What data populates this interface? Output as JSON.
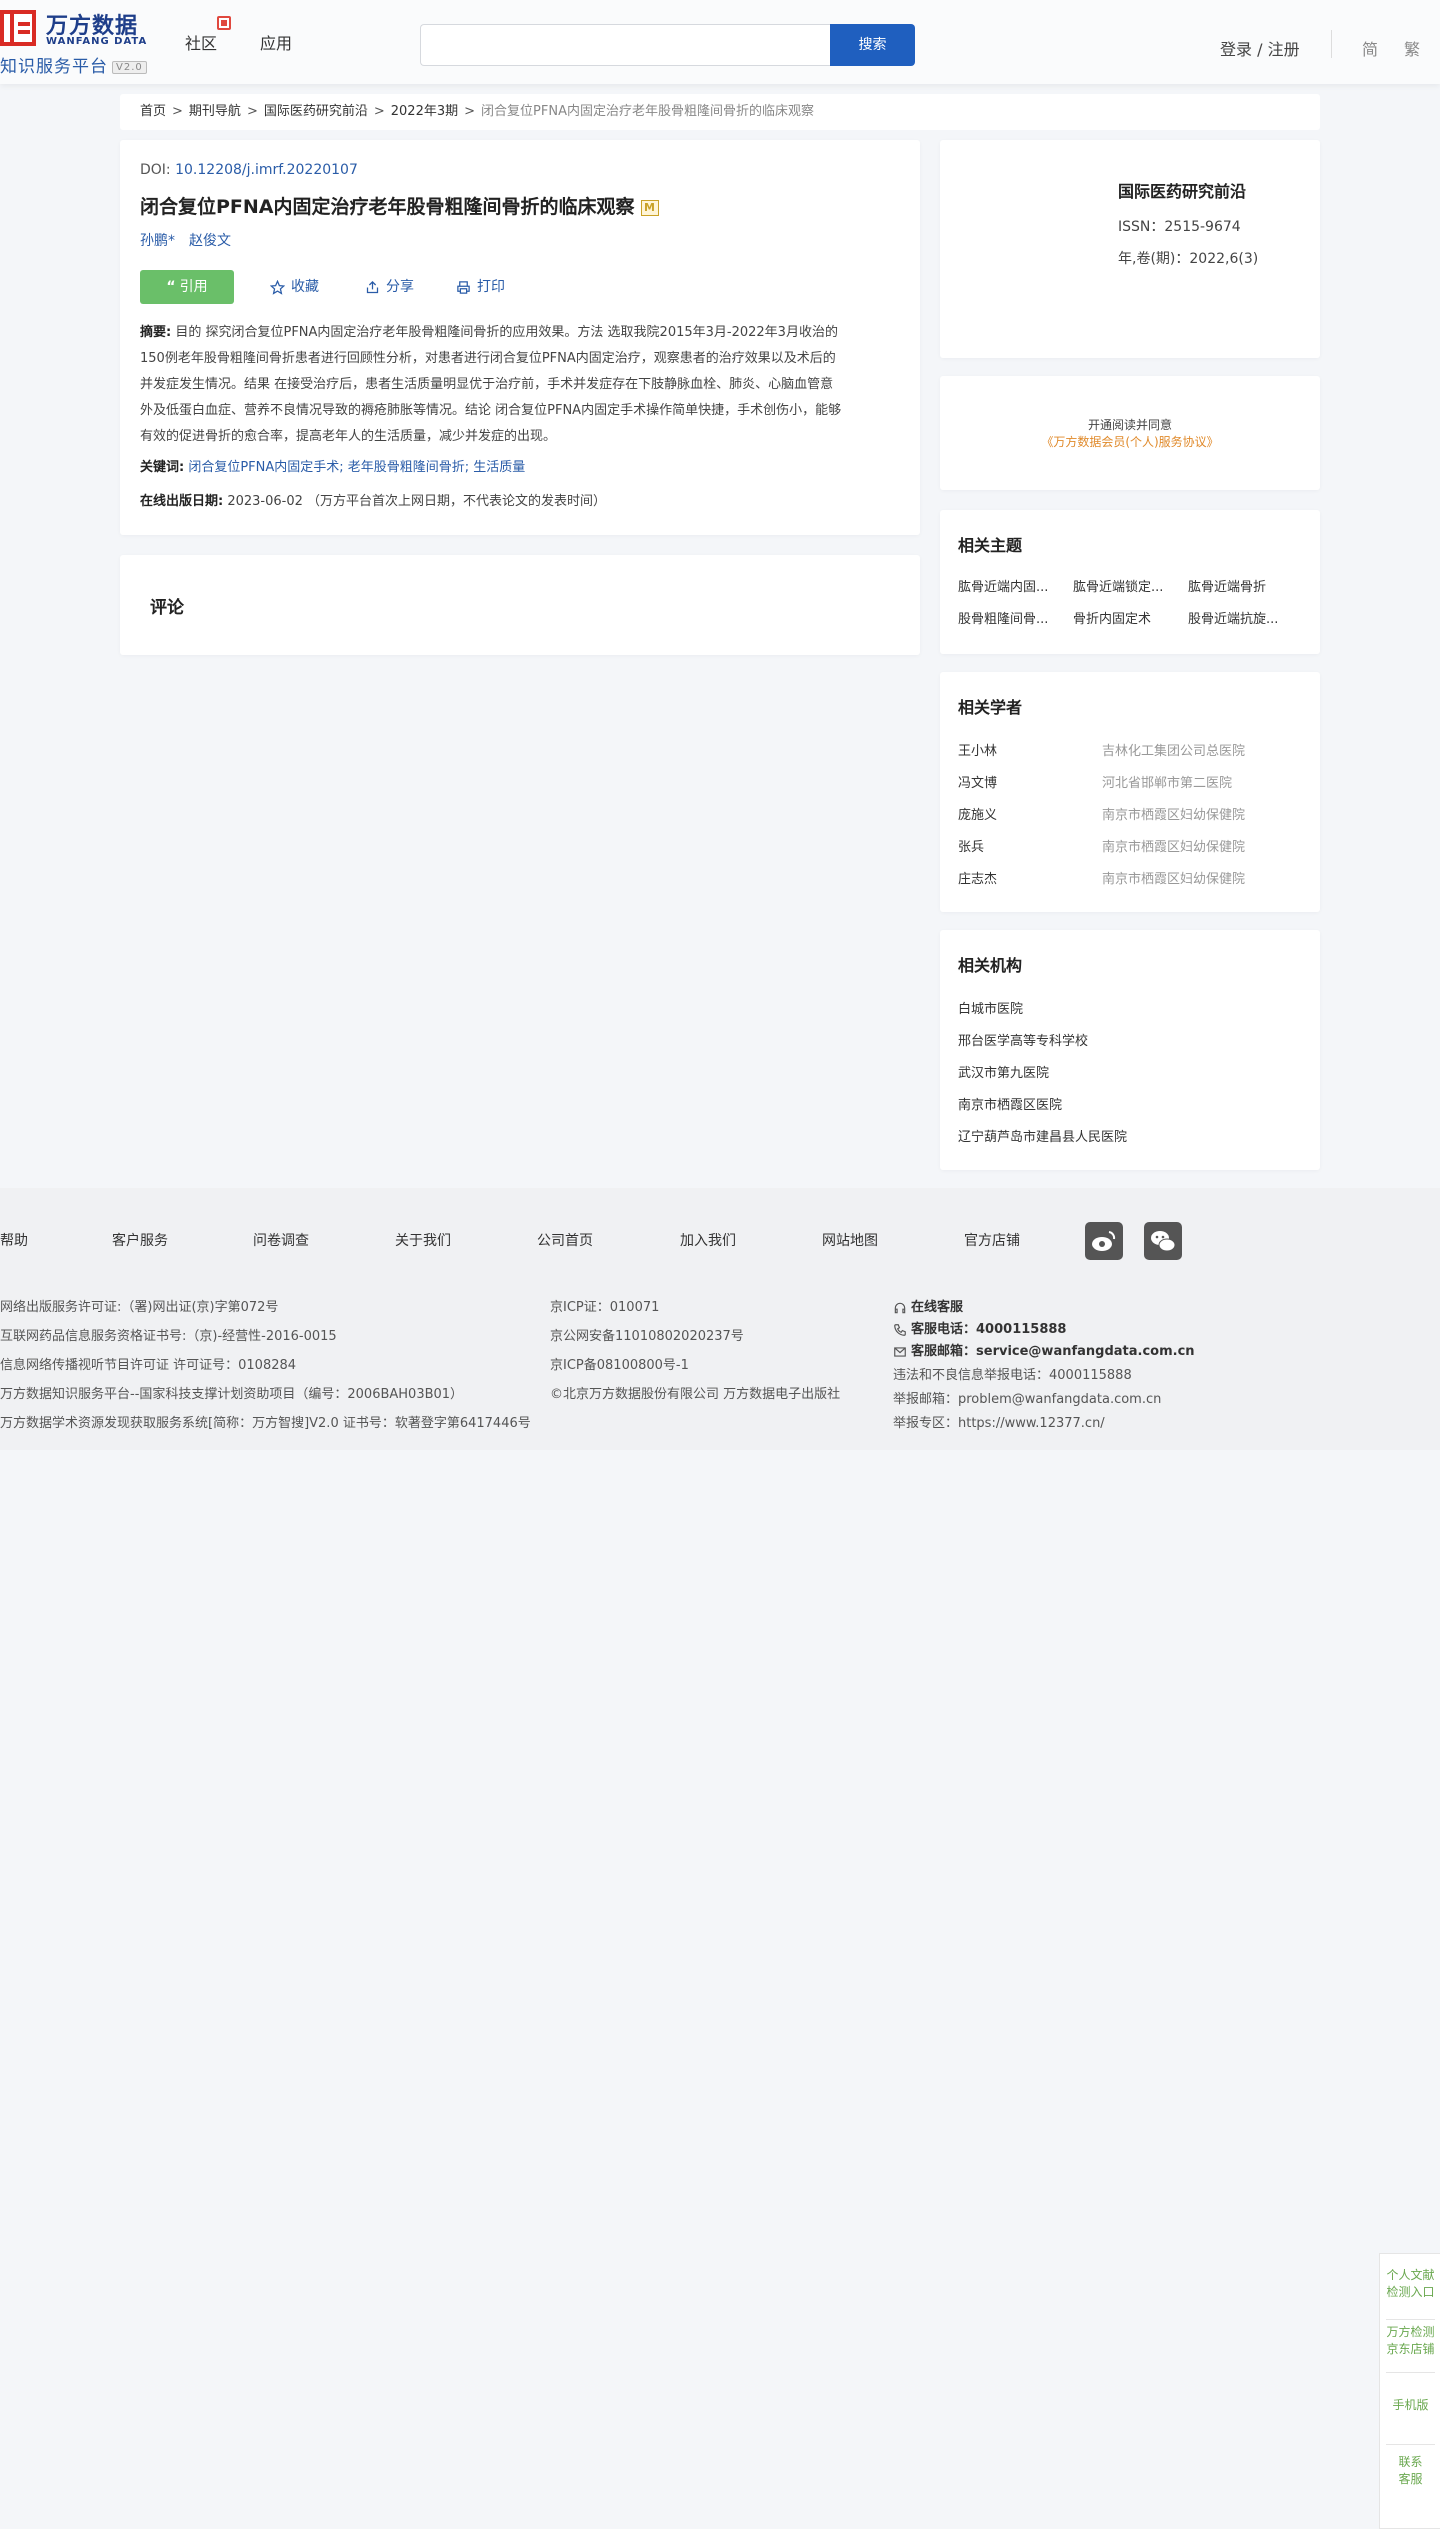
{
  "header": {
    "logo_cn": "万方数据",
    "logo_en": "WANFANG DATA",
    "logo_sub": "知识服务平台",
    "logo_ver": "V2.0",
    "nav_community": "社区",
    "nav_apps": "应用",
    "search_placeholder": "",
    "search_button": "搜索",
    "login": "登录 / 注册",
    "lang_simplified": "简",
    "lang_traditional": "繁"
  },
  "breadcrumb": {
    "items": [
      "首页",
      "期刊导航",
      "国际医药研究前沿",
      "2022年3期"
    ],
    "separator": ">",
    "current": "闭合复位PFNA内固定治疗老年股骨粗隆间骨折的临床观察"
  },
  "article": {
    "doi_label": "DOI: ",
    "doi": "10.12208/j.imrf.20220107",
    "title": "闭合复位PFNA内固定治疗老年股骨粗隆间骨折的临床观察",
    "title_badge": "M",
    "authors": [
      "孙鹏*",
      "赵俊文"
    ],
    "actions": {
      "cite": "引用",
      "favorite": "收藏",
      "share": "分享",
      "print": "打印"
    },
    "abstract_label": "摘要:",
    "abstract_lines": [
      "目的 探究闭合复位PFNA内固定治疗老年股骨粗隆间骨折的应用效果。方法 选取我院2015年3月-2022年3月收治的",
      "150例老年股骨粗隆间骨折患者进行回顾性分析，对患者进行闭合复位PFNA内固定治疗，观察患者的治疗效果以及术后的",
      "并发症发生情况。结果 在接受治疗后，患者生活质量明显优于治疗前，手术并发症存在下肢静脉血栓、肺炎、心脑血管意",
      "外及低蛋白血症、营养不良情况导致的褥疮肺胀等情况。结论 闭合复位PFNA内固定手术操作简单快捷，手术创伤小，能够",
      "有效的促进骨折的愈合率，提高老年人的生活质量，减少并发症的出现。"
    ],
    "keywords_label": "关键词:",
    "keywords": "闭合复位PFNA内固定手术; 老年股骨粗隆间骨折; 生活质量",
    "pubdate_label": "在线出版日期:",
    "pubdate": "2023-06-02 （万方平台首次上网日期，不代表论文的发表时间）"
  },
  "comments": {
    "title": "评论"
  },
  "journal": {
    "name": "国际医药研究前沿",
    "issn": "ISSN：2515-9674",
    "volume": "年,卷(期)：2022,6(3)"
  },
  "notice": {
    "line1": "开通阅读并同意",
    "line2": "《万方数据会员(个人)服务协议》"
  },
  "related_topics": {
    "title": "相关主题",
    "items": [
      "肱骨近端内固...",
      "肱骨近端锁定...",
      "肱骨近端骨折",
      "股骨粗隆间骨...",
      "骨折内固定术",
      "股骨近端抗旋..."
    ]
  },
  "related_scholars": {
    "title": "相关学者",
    "items": [
      {
        "name": "王小林",
        "org": "吉林化工集团公司总医院"
      },
      {
        "name": "冯文博",
        "org": "河北省邯郸市第二医院"
      },
      {
        "name": "庞施义",
        "org": "南京市栖霞区妇幼保健院"
      },
      {
        "name": "张兵",
        "org": "南京市栖霞区妇幼保健院"
      },
      {
        "name": "庄志杰",
        "org": "南京市栖霞区妇幼保健院"
      }
    ]
  },
  "related_institutions": {
    "title": "相关机构",
    "items": [
      "白城市医院",
      "邢台医学高等专科学校",
      "武汉市第九医院",
      "南京市栖霞区医院",
      "辽宁葫芦岛市建昌县人民医院"
    ]
  },
  "footer": {
    "links": [
      "帮助",
      "客户服务",
      "问卷调查",
      "关于我们",
      "公司首页",
      "加入我们",
      "网站地图",
      "官方店铺"
    ],
    "col1": [
      "网络出版服务许可证:（署)网出证(京)字第072号",
      "互联网药品信息服务资格证书号:（京)-经营性-2016-0015",
      "信息网络传播视听节目许可证 许可证号：0108284",
      "万方数据知识服务平台--国家科技支撑计划资助项目（编号：2006BAH03B01）",
      "万方数据学术资源发现获取服务系统[简称：万方智搜]V2.0 证书号：软著登字第6417446号"
    ],
    "col2": [
      "京ICP证：010071",
      "京公网安备11010802020237号",
      "京ICP备08100800号-1",
      "©北京万方数据股份有限公司 万方数据电子出版社"
    ],
    "online_service": "在线客服",
    "phone_label": "客服电话：",
    "phone": "4000115888",
    "email_label": "客服邮箱：",
    "email": "service@wanfangdata.com.cn",
    "report_phone": "违法和不良信息举报电话：4000115888",
    "report_email": "举报邮箱：problem@wanfangdata.com.cn",
    "report_zone": "举报专区：https://www.12377.cn/"
  },
  "float_bar": {
    "items": [
      [
        "个人文献",
        "检测入口"
      ],
      [
        "万方检测",
        "京东店铺"
      ],
      [
        "手机版"
      ],
      [
        "联系",
        "客服"
      ]
    ]
  },
  "colors": {
    "brand_blue": "#1f5fbf",
    "link_blue": "#2a5ca8",
    "cite_green": "#6abf69",
    "notice_orange": "#e08a2b",
    "logo_red": "#d92b24"
  }
}
